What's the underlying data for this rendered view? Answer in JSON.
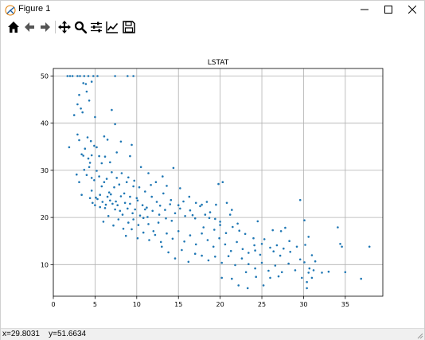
{
  "window": {
    "title": "Figure 1"
  },
  "status": {
    "x_label": "x=",
    "x_value": "29.8031",
    "y_label": "y=",
    "y_value": "51.6634"
  },
  "toolbar": {
    "items": [
      {
        "name": "home-icon"
      },
      {
        "name": "back-icon"
      },
      {
        "name": "forward-icon"
      },
      {
        "name": "pan-icon"
      },
      {
        "name": "zoom-icon"
      },
      {
        "name": "subplots-icon"
      },
      {
        "name": "customize-icon"
      },
      {
        "name": "save-icon"
      }
    ]
  },
  "colors": {
    "marker": "#1f77b4",
    "grid": "#b0b0b0",
    "axis": "#000000"
  },
  "chart_data": {
    "type": "scatter",
    "title": "LSTAT",
    "xlabel": "",
    "ylabel": "",
    "xlim": [
      0,
      39.5
    ],
    "ylim": [
      3.3,
      51.6
    ],
    "xticks": [
      0,
      5,
      10,
      15,
      20,
      25,
      30,
      35
    ],
    "yticks": [
      10,
      20,
      30,
      40,
      50
    ],
    "grid": true,
    "series": [
      {
        "points": [
          [
            1.7,
            50
          ],
          [
            2.0,
            50
          ],
          [
            2.3,
            50
          ],
          [
            2.9,
            50
          ],
          [
            3.2,
            50
          ],
          [
            3.7,
            50
          ],
          [
            4.2,
            50
          ],
          [
            4.8,
            50
          ],
          [
            5.3,
            50
          ],
          [
            7.4,
            50
          ],
          [
            8.9,
            50
          ],
          [
            9.6,
            50
          ],
          [
            2.5,
            41.7
          ],
          [
            2.9,
            44
          ],
          [
            3.1,
            46
          ],
          [
            3.3,
            43.1
          ],
          [
            3.5,
            42.3
          ],
          [
            3.6,
            48.5
          ],
          [
            3.9,
            48.3
          ],
          [
            4.0,
            46.7
          ],
          [
            4.3,
            44.8
          ],
          [
            4.6,
            48.8
          ],
          [
            4.1,
            37
          ],
          [
            4.5,
            36.2
          ],
          [
            1.9,
            34.9
          ],
          [
            2.9,
            37.6
          ],
          [
            3.1,
            36.4
          ],
          [
            3.4,
            33.4
          ],
          [
            3.6,
            33.1
          ],
          [
            3.8,
            34.6
          ],
          [
            4.2,
            32.5
          ],
          [
            4.4,
            31.6
          ],
          [
            4.6,
            33.2
          ],
          [
            4.9,
            35.2
          ],
          [
            5.2,
            34.9
          ],
          [
            5.5,
            33
          ],
          [
            7.0,
            42.8
          ],
          [
            7.4,
            39.8
          ],
          [
            5.0,
            41.3
          ],
          [
            6.1,
            37.2
          ],
          [
            6.5,
            36.5
          ],
          [
            7.6,
            33.8
          ],
          [
            8.1,
            36.1
          ],
          [
            9.4,
            35.4
          ],
          [
            9.2,
            33
          ],
          [
            5.8,
            31.5
          ],
          [
            6.2,
            32.9
          ],
          [
            6.8,
            31.7
          ],
          [
            2.8,
            29.1
          ],
          [
            3.1,
            27.5
          ],
          [
            3.4,
            24.8
          ],
          [
            3.7,
            30.1
          ],
          [
            4.0,
            29
          ],
          [
            4.3,
            30.7
          ],
          [
            4.6,
            28.4
          ],
          [
            4.9,
            27.9
          ],
          [
            5.2,
            29.9
          ],
          [
            5.5,
            28.7
          ],
          [
            5.8,
            26.6
          ],
          [
            6.1,
            27.5
          ],
          [
            6.4,
            28.2
          ],
          [
            6.7,
            25.3
          ],
          [
            7.0,
            29.6
          ],
          [
            7.3,
            26.4
          ],
          [
            7.6,
            28.4
          ],
          [
            7.9,
            27
          ],
          [
            8.2,
            29.4
          ],
          [
            8.5,
            25.1
          ],
          [
            8.8,
            27.5
          ],
          [
            9.2,
            24.4
          ],
          [
            9.6,
            26.6
          ],
          [
            10.0,
            24.1
          ],
          [
            4.4,
            24.1
          ],
          [
            4.7,
            23.1
          ],
          [
            5.0,
            22.6
          ],
          [
            5.3,
            23.9
          ],
          [
            5.6,
            24.8
          ],
          [
            5.9,
            23.3
          ],
          [
            6.2,
            22
          ],
          [
            6.5,
            24.4
          ],
          [
            6.8,
            23.6
          ],
          [
            7.1,
            22.9
          ],
          [
            7.4,
            21.7
          ],
          [
            7.7,
            22.6
          ],
          [
            8.0,
            21.4
          ],
          [
            8.3,
            20.6
          ],
          [
            8.6,
            23.1
          ],
          [
            8.9,
            21.9
          ],
          [
            9.2,
            22.9
          ],
          [
            9.5,
            20.9
          ],
          [
            9.8,
            21.7
          ],
          [
            10.1,
            23.6
          ],
          [
            10.4,
            20.4
          ],
          [
            10.7,
            22.6
          ],
          [
            11.0,
            21.7
          ],
          [
            11.3,
            20.1
          ],
          [
            6.0,
            19.1
          ],
          [
            6.6,
            20.3
          ],
          [
            7.2,
            18.3
          ],
          [
            7.8,
            19.6
          ],
          [
            8.4,
            17.6
          ],
          [
            9.0,
            18.9
          ],
          [
            9.6,
            19.6
          ],
          [
            10.2,
            18.4
          ],
          [
            10.8,
            19.9
          ],
          [
            11.4,
            18.6
          ],
          [
            12.0,
            17.1
          ],
          [
            12.6,
            18.9
          ],
          [
            10.5,
            30.7
          ],
          [
            11.4,
            29.4
          ],
          [
            12.3,
            27.5
          ],
          [
            13.1,
            28.7
          ],
          [
            13.6,
            26.7
          ],
          [
            14.4,
            30.5
          ],
          [
            15.2,
            26.2
          ],
          [
            14.1,
            23.7
          ],
          [
            13.2,
            25.1
          ],
          [
            12.4,
            23.3
          ],
          [
            11.8,
            24.4
          ],
          [
            12.8,
            22.5
          ],
          [
            13.4,
            21.6
          ],
          [
            14.0,
            22.8
          ],
          [
            14.6,
            20.9
          ],
          [
            15.2,
            21.9
          ],
          [
            15.8,
            20.3
          ],
          [
            16.4,
            21.5
          ],
          [
            17.0,
            19.8
          ],
          [
            17.6,
            22.4
          ],
          [
            18.2,
            20.6
          ],
          [
            18.8,
            21.1
          ],
          [
            19.4,
            19.7
          ],
          [
            20.0,
            18.4
          ],
          [
            8.7,
            16.1
          ],
          [
            9.4,
            17.5
          ],
          [
            10.1,
            15.6
          ],
          [
            10.8,
            16.8
          ],
          [
            11.5,
            15.2
          ],
          [
            12.2,
            16.3
          ],
          [
            12.9,
            14.8
          ],
          [
            13.6,
            16.6
          ],
          [
            14.3,
            15.5
          ],
          [
            15.0,
            17.1
          ],
          [
            15.7,
            14.9
          ],
          [
            16.4,
            16.2
          ],
          [
            17.1,
            14.3
          ],
          [
            17.8,
            16.6
          ],
          [
            18.5,
            15.2
          ],
          [
            19.2,
            13.8
          ],
          [
            19.9,
            15.6
          ],
          [
            20.6,
            14.3
          ],
          [
            21.3,
            12.9
          ],
          [
            22.0,
            14.8
          ],
          [
            22.7,
            13.3
          ],
          [
            23.4,
            12.5
          ],
          [
            24.1,
            14.1
          ],
          [
            24.8,
            12.1
          ],
          [
            13.0,
            13.8
          ],
          [
            13.8,
            12.6
          ],
          [
            14.6,
            11.3
          ],
          [
            15.4,
            13.1
          ],
          [
            16.2,
            10.6
          ],
          [
            17.0,
            12.3
          ],
          [
            17.8,
            11.9
          ],
          [
            18.6,
            10.9
          ],
          [
            19.4,
            11.7
          ],
          [
            20.2,
            10.4
          ],
          [
            21.0,
            11.8
          ],
          [
            21.8,
            9.9
          ],
          [
            22.6,
            11.3
          ],
          [
            23.4,
            10.1
          ],
          [
            24.2,
            9.2
          ],
          [
            25.0,
            10.4
          ],
          [
            25.8,
            8.7
          ],
          [
            26.6,
            9.8
          ],
          [
            27.4,
            8.4
          ],
          [
            28.2,
            10.2
          ],
          [
            29.0,
            8.8
          ],
          [
            29.8,
            7.2
          ],
          [
            30.6,
            8.3
          ],
          [
            31.4,
            10.7
          ],
          [
            18.0,
            17.9
          ],
          [
            18.7,
            19.9
          ],
          [
            19.3,
            17.4
          ],
          [
            20.0,
            19.1
          ],
          [
            20.7,
            16.7
          ],
          [
            21.2,
            20.6
          ],
          [
            21.5,
            18
          ],
          [
            22.3,
            17.2
          ],
          [
            23.0,
            16.5
          ],
          [
            24.0,
            15.6
          ],
          [
            24.5,
            19.2
          ],
          [
            25.3,
            15.4
          ],
          [
            19.8,
            27.1
          ],
          [
            20.3,
            27.5
          ],
          [
            20.8,
            23.1
          ],
          [
            21.4,
            21.6
          ],
          [
            19.5,
            22.7
          ],
          [
            22.1,
            18.7
          ],
          [
            26.3,
            17.3
          ],
          [
            27.3,
            17.1
          ],
          [
            27.8,
            17.8
          ],
          [
            29.6,
            23.7
          ],
          [
            30.1,
            19.4
          ],
          [
            28.3,
            15
          ],
          [
            26.0,
            13.6
          ],
          [
            26.8,
            14.1
          ],
          [
            27.6,
            13.4
          ],
          [
            28.4,
            12.7
          ],
          [
            29.2,
            13.8
          ],
          [
            30.2,
            14.2
          ],
          [
            30.6,
            15.9
          ],
          [
            31.0,
            12
          ],
          [
            29.6,
            11.1
          ],
          [
            30.1,
            10.5
          ],
          [
            30.7,
            9.2
          ],
          [
            30.4,
            6.3
          ],
          [
            26.0,
            7.2
          ],
          [
            27.0,
            7.5
          ],
          [
            25.2,
            5.6
          ],
          [
            30.4,
            5
          ],
          [
            31.2,
            8.8
          ],
          [
            32.2,
            8.3
          ],
          [
            20.2,
            7.2
          ],
          [
            21.4,
            7
          ],
          [
            22.2,
            5.6
          ],
          [
            23.3,
            5
          ],
          [
            24.3,
            7.4
          ],
          [
            23.1,
            8.4
          ],
          [
            34.4,
            14.4
          ],
          [
            34.6,
            13.8
          ],
          [
            34.1,
            17.9
          ],
          [
            37.9,
            13.8
          ],
          [
            36.9,
            7
          ],
          [
            33.0,
            8.5
          ],
          [
            31.0,
            7.2
          ],
          [
            35.0,
            8.4
          ],
          [
            24.2,
            13
          ],
          [
            25.0,
            14.4
          ],
          [
            26.4,
            12.8
          ],
          [
            27.2,
            11.9
          ],
          [
            15.0,
            22.6
          ],
          [
            15.6,
            23.4
          ],
          [
            16.3,
            24.4
          ],
          [
            17.1,
            23.1
          ],
          [
            17.8,
            22.7
          ],
          [
            18.4,
            23.3
          ],
          [
            16.7,
            20.5
          ],
          [
            14.2,
            19.3
          ],
          [
            13.5,
            19.8
          ],
          [
            12.7,
            20.6
          ],
          [
            11.9,
            21.4
          ],
          [
            11.2,
            22.1
          ],
          [
            9.0,
            28.5
          ],
          [
            9.7,
            27.8
          ],
          [
            10.3,
            26.4
          ],
          [
            11.0,
            25.5
          ],
          [
            11.7,
            26.9
          ],
          [
            7.5,
            23.4
          ],
          [
            6.3,
            22.7
          ],
          [
            5.6,
            22.2
          ],
          [
            5.1,
            24.2
          ],
          [
            4.6,
            25.7
          ],
          [
            6.9,
            24.9
          ],
          [
            8.1,
            24.5
          ]
        ]
      }
    ]
  }
}
